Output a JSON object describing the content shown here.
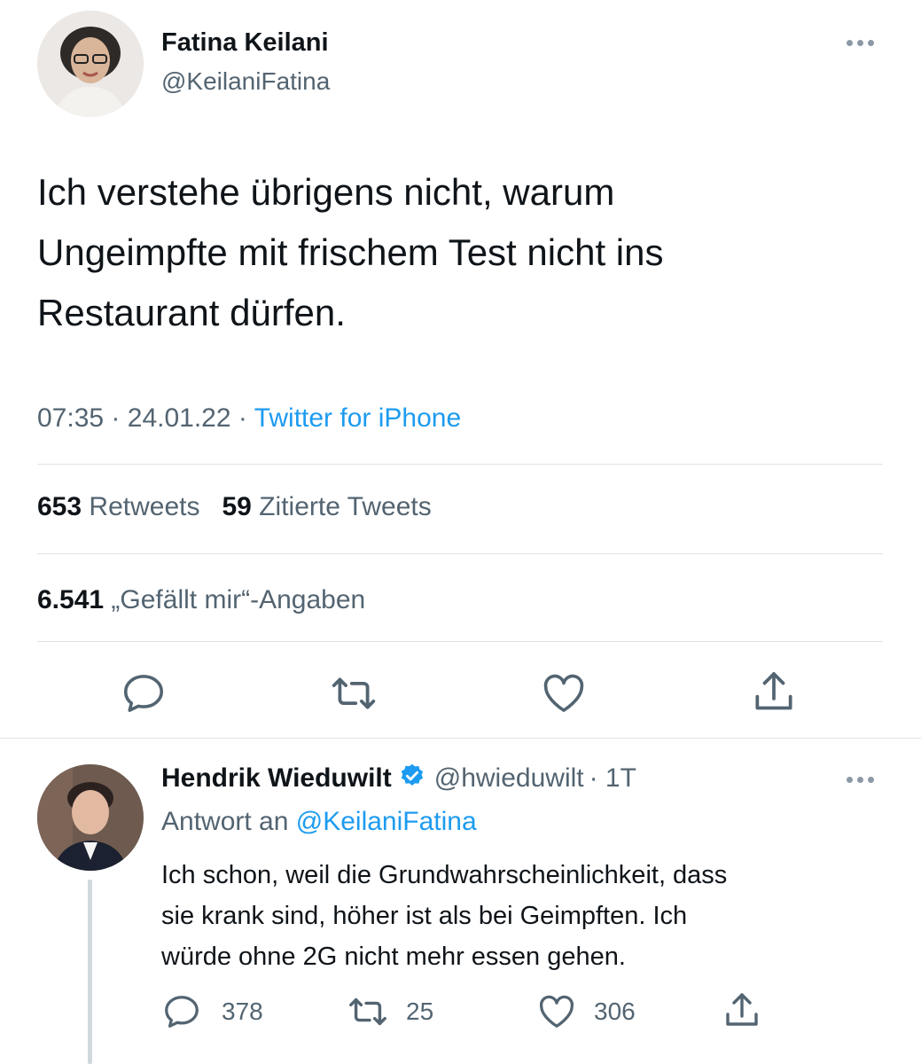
{
  "tweet": {
    "author_name": "Fatina Keilani",
    "author_handle": "@KeilaniFatina",
    "text_line1": "Ich verstehe übrigens nicht, warum",
    "text_line2": "Ungeimpfte mit frischem Test nicht ins",
    "text_line3": "Restaurant dürfen.",
    "time": "07:35",
    "date": "24.01.22",
    "separator": "·",
    "source": "Twitter for iPhone",
    "retweets_count": "653",
    "retweets_label": "Retweets",
    "quotes_count": "59",
    "quotes_label": "Zitierte Tweets",
    "likes_count": "6.541",
    "likes_label": "„Gefällt mir“-Angaben"
  },
  "reply": {
    "author_name": "Hendrik Wieduwilt",
    "author_handle": "@hwieduwilt",
    "age": "· 1T",
    "reply_prefix": "Antwort an",
    "reply_to": "@KeilaniFatina",
    "text_line1": "Ich schon, weil die Grundwahrscheinlichkeit, dass",
    "text_line2": "sie krank sind, höher ist als bei Geimpften. Ich",
    "text_line3": "würde ohne 2G nicht mehr essen gehen.",
    "reply_count": "378",
    "retweet_count": "25",
    "like_count": "306"
  },
  "colors": {
    "link": "#1d9bf0",
    "secondary_text": "#536471",
    "icon": "#536471",
    "verified": "#1d9bf0"
  },
  "icons": [
    "more-icon",
    "reply-icon",
    "retweet-icon",
    "like-icon",
    "share-icon",
    "verified-icon"
  ]
}
